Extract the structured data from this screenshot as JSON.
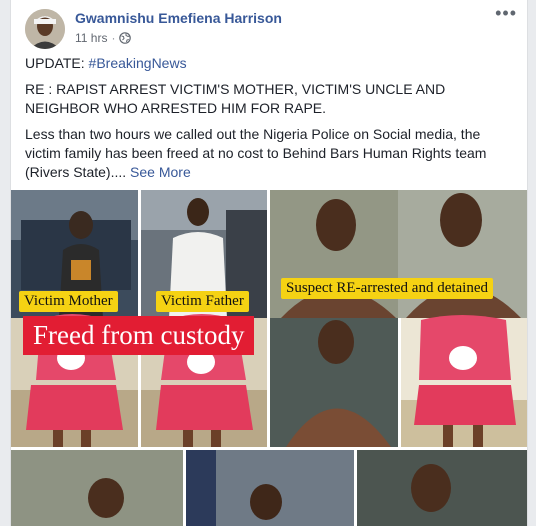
{
  "post": {
    "author": "Gwamnishu Emefiena Harrison",
    "time": "11 hrs",
    "dot": "·",
    "more_icon": "more-horizontal-icon",
    "privacy_icon": "globe-icon",
    "update_prefix": "UPDATE: ",
    "hashtag": "#BreakingNews",
    "headline": "RE : RAPIST ARREST VICTIM'S MOTHER, VICTIM'S UNCLE AND NEIGHBOR WHO ARRESTED HIM FOR RAPE.",
    "body": "Less than two hours we called out the Nigeria Police on Social media, the victim family has been freed at no cost to Behind Bars Human Rights team (Rivers State)....",
    "see_more": "See More"
  },
  "photo_labels": {
    "victim_mother": "Victim Mother",
    "victim_father": "Victim Father",
    "freed": "Freed from custody",
    "suspect": "Suspect RE-arrested and detained"
  },
  "colors": {
    "link": "#385898",
    "yellow_label": "#f5d213",
    "red_label": "#e21d33"
  }
}
